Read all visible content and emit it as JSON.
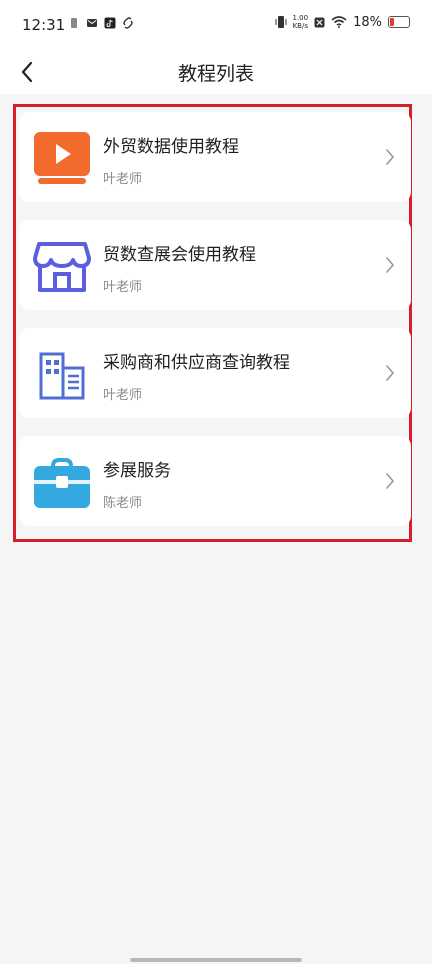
{
  "status_bar": {
    "time": "12:31",
    "net_speed_value": "1.00",
    "net_speed_unit": "KB/s",
    "battery_percent": "18%"
  },
  "nav": {
    "title": "教程列表"
  },
  "tutorials": [
    {
      "title": "外贸数据使用教程",
      "teacher": "叶老师",
      "icon": "video-play-icon",
      "color": "#f26a2e"
    },
    {
      "title": "贸数查展会使用教程",
      "teacher": "叶老师",
      "icon": "store-icon",
      "color": "#5b5ee0"
    },
    {
      "title": "采购商和供应商查询教程",
      "teacher": "叶老师",
      "icon": "building-icon",
      "color": "#4f6fd6"
    },
    {
      "title": "参展服务",
      "teacher": "陈老师",
      "icon": "briefcase-icon",
      "color": "#33a9e0"
    }
  ],
  "highlight_color": "#d81e2a"
}
